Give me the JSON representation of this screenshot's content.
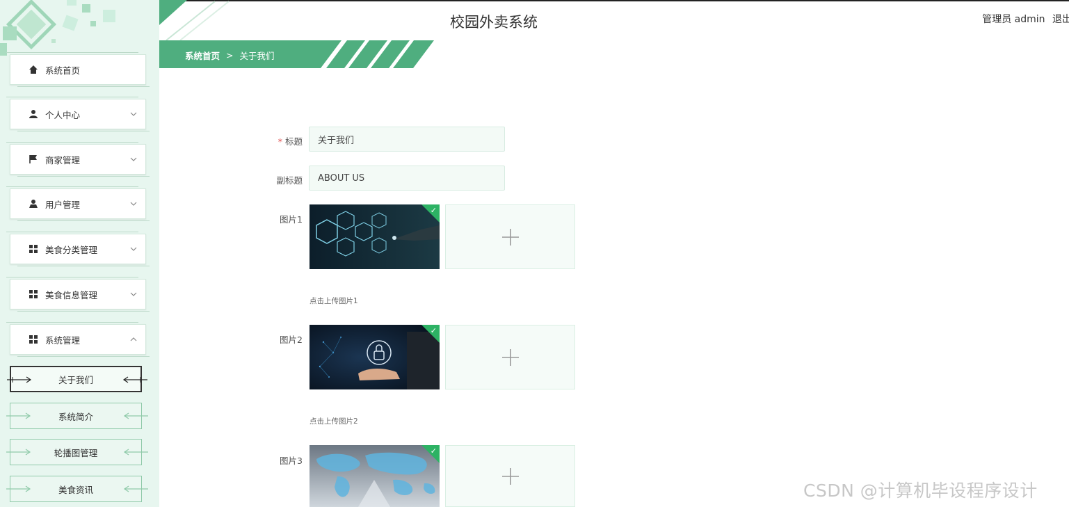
{
  "app": {
    "title": "校园外卖系统",
    "user_role": "管理员 admin",
    "logout_label": "退出"
  },
  "colors": {
    "accent": "#4fae7f",
    "sidebar_bg": "#e7f6ef",
    "input_bg": "#f3faf6",
    "required": "#e05050"
  },
  "sidebar": {
    "items": [
      {
        "label": "系统首页",
        "icon": "home-icon"
      },
      {
        "label": "个人中心",
        "icon": "person-icon"
      },
      {
        "label": "商家管理",
        "icon": "flag-icon"
      },
      {
        "label": "用户管理",
        "icon": "user-icon"
      },
      {
        "label": "美食分类管理",
        "icon": "grid-icon"
      },
      {
        "label": "美食信息管理",
        "icon": "grid-icon"
      },
      {
        "label": "系统管理",
        "icon": "grid-icon"
      }
    ],
    "sub_items": [
      {
        "label": "关于我们",
        "active": true
      },
      {
        "label": "系统简介",
        "active": false
      },
      {
        "label": "轮播图管理",
        "active": false
      },
      {
        "label": "美食资讯",
        "active": false
      }
    ]
  },
  "breadcrumb": {
    "home": "系统首页",
    "separator": ">",
    "current": "关于我们"
  },
  "form": {
    "title_label": "标题",
    "required_mark": "*",
    "title_value": "关于我们",
    "subtitle_label": "副标题",
    "subtitle_value": "ABOUT US",
    "image_fields": [
      {
        "label": "图片1",
        "hint": "点击上传图片1"
      },
      {
        "label": "图片2",
        "hint": "点击上传图片2"
      },
      {
        "label": "图片3",
        "hint": ""
      }
    ]
  },
  "watermark": "CSDN @计算机毕设程序设计"
}
